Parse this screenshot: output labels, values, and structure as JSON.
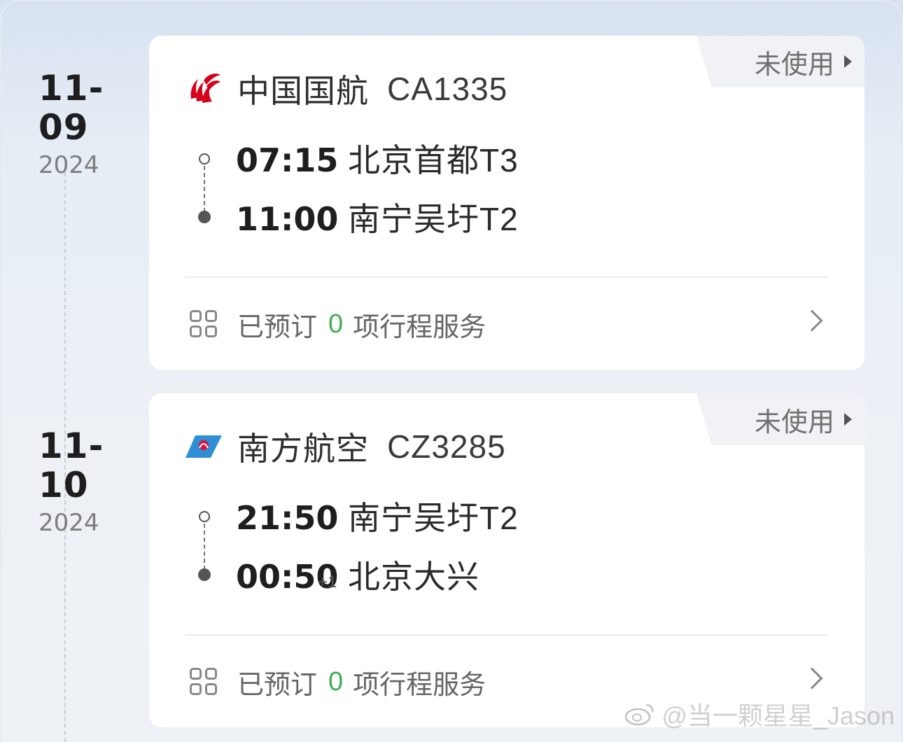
{
  "watermark": {
    "text": "@当一颗星星_Jason"
  },
  "trips": [
    {
      "date": {
        "month_day": "11-09",
        "year": "2024"
      },
      "status": "未使用",
      "airline": {
        "name": "中国国航",
        "flight_no": "CA1335",
        "logo": "air-china-logo",
        "logo_color": "#d6001c"
      },
      "departure": {
        "time": "07:15",
        "airport": "北京首都T3"
      },
      "arrival": {
        "time": "11:00",
        "day_offset": "",
        "airport": "南宁吴圩T2"
      },
      "services": {
        "prefix": "已预订",
        "count": "0",
        "suffix": "项行程服务"
      }
    },
    {
      "date": {
        "month_day": "11-10",
        "year": "2024"
      },
      "status": "未使用",
      "airline": {
        "name": "南方航空",
        "flight_no": "CZ3285",
        "logo": "china-southern-logo",
        "logo_color": "#2d8fd5"
      },
      "departure": {
        "time": "21:50",
        "airport": "南宁吴圩T2"
      },
      "arrival": {
        "time": "00:50",
        "day_offset": "+1",
        "airport": "北京大兴"
      },
      "services": {
        "prefix": "已预订",
        "count": "0",
        "suffix": "项行程服务"
      }
    }
  ],
  "colors": {
    "service_count": "#3fae52",
    "background": "#e6edf5",
    "card": "#ffffff"
  }
}
